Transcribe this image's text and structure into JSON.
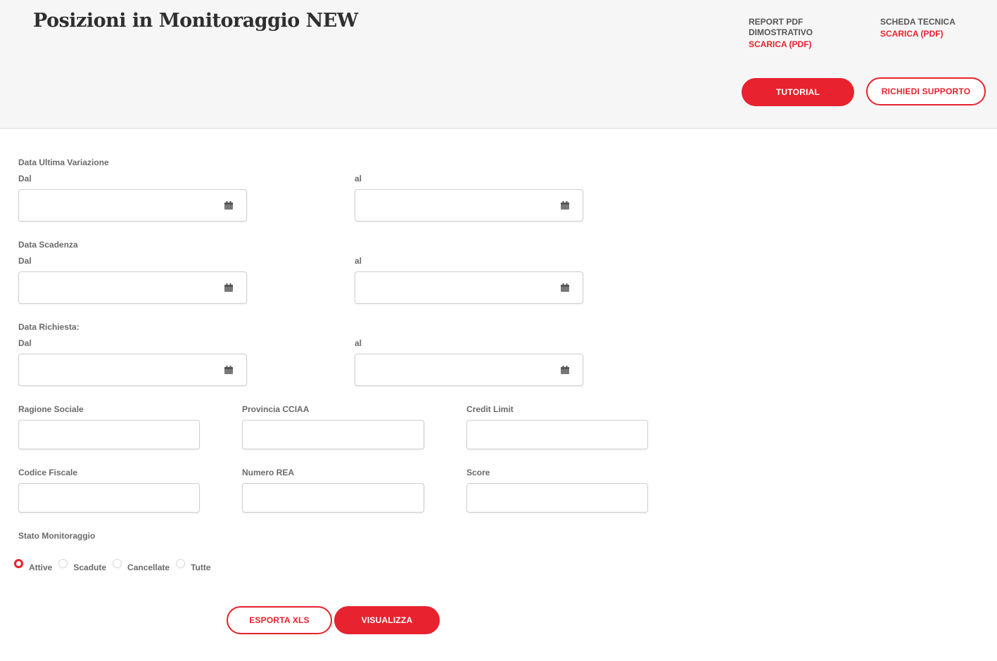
{
  "header": {
    "title": "Posizioni in Monitoraggio NEW",
    "report": {
      "title_line1": "REPORT PDF",
      "title_line2": "DIMOSTRATIVO",
      "link": "SCARICA (PDF)"
    },
    "scheda": {
      "title": "SCHEDA TECNICA",
      "link": "SCARICA (PDF)"
    },
    "tutorial_label": "TUTORIAL",
    "support_label": "RICHIEDI SUPPORTO"
  },
  "filters": {
    "ultima_variazione": {
      "label": "Data Ultima Variazione",
      "from_label": "Dal",
      "to_label": "al",
      "from_value": "",
      "to_value": ""
    },
    "scadenza": {
      "label": "Data Scadenza",
      "from_label": "Dal",
      "to_label": "al",
      "from_value": "",
      "to_value": ""
    },
    "richiesta": {
      "label": "Data Richiesta:",
      "from_label": "Dal",
      "to_label": "al",
      "from_value": "",
      "to_value": ""
    },
    "ragione_sociale": {
      "label": "Ragione Sociale",
      "value": ""
    },
    "provincia_cciaa": {
      "label": "Provincia CCIAA",
      "value": ""
    },
    "credit_limit": {
      "label": "Credit Limit",
      "value": ""
    },
    "codice_fiscale": {
      "label": "Codice Fiscale",
      "value": ""
    },
    "numero_rea": {
      "label": "Numero REA",
      "value": ""
    },
    "score": {
      "label": "Score",
      "value": ""
    },
    "stato": {
      "label": "Stato Monitoraggio",
      "options": [
        "Attive",
        "Scadute",
        "Cancellate",
        "Tutte"
      ],
      "selected": "Attive"
    }
  },
  "actions": {
    "export_label": "ESPORTA XLS",
    "view_label": "VISUALIZZA"
  },
  "colors": {
    "accent": "#e8222f",
    "header_bg": "#f6f6f6",
    "label": "#6a6a6a"
  },
  "icons": {
    "date_field": "calendar-icon"
  }
}
